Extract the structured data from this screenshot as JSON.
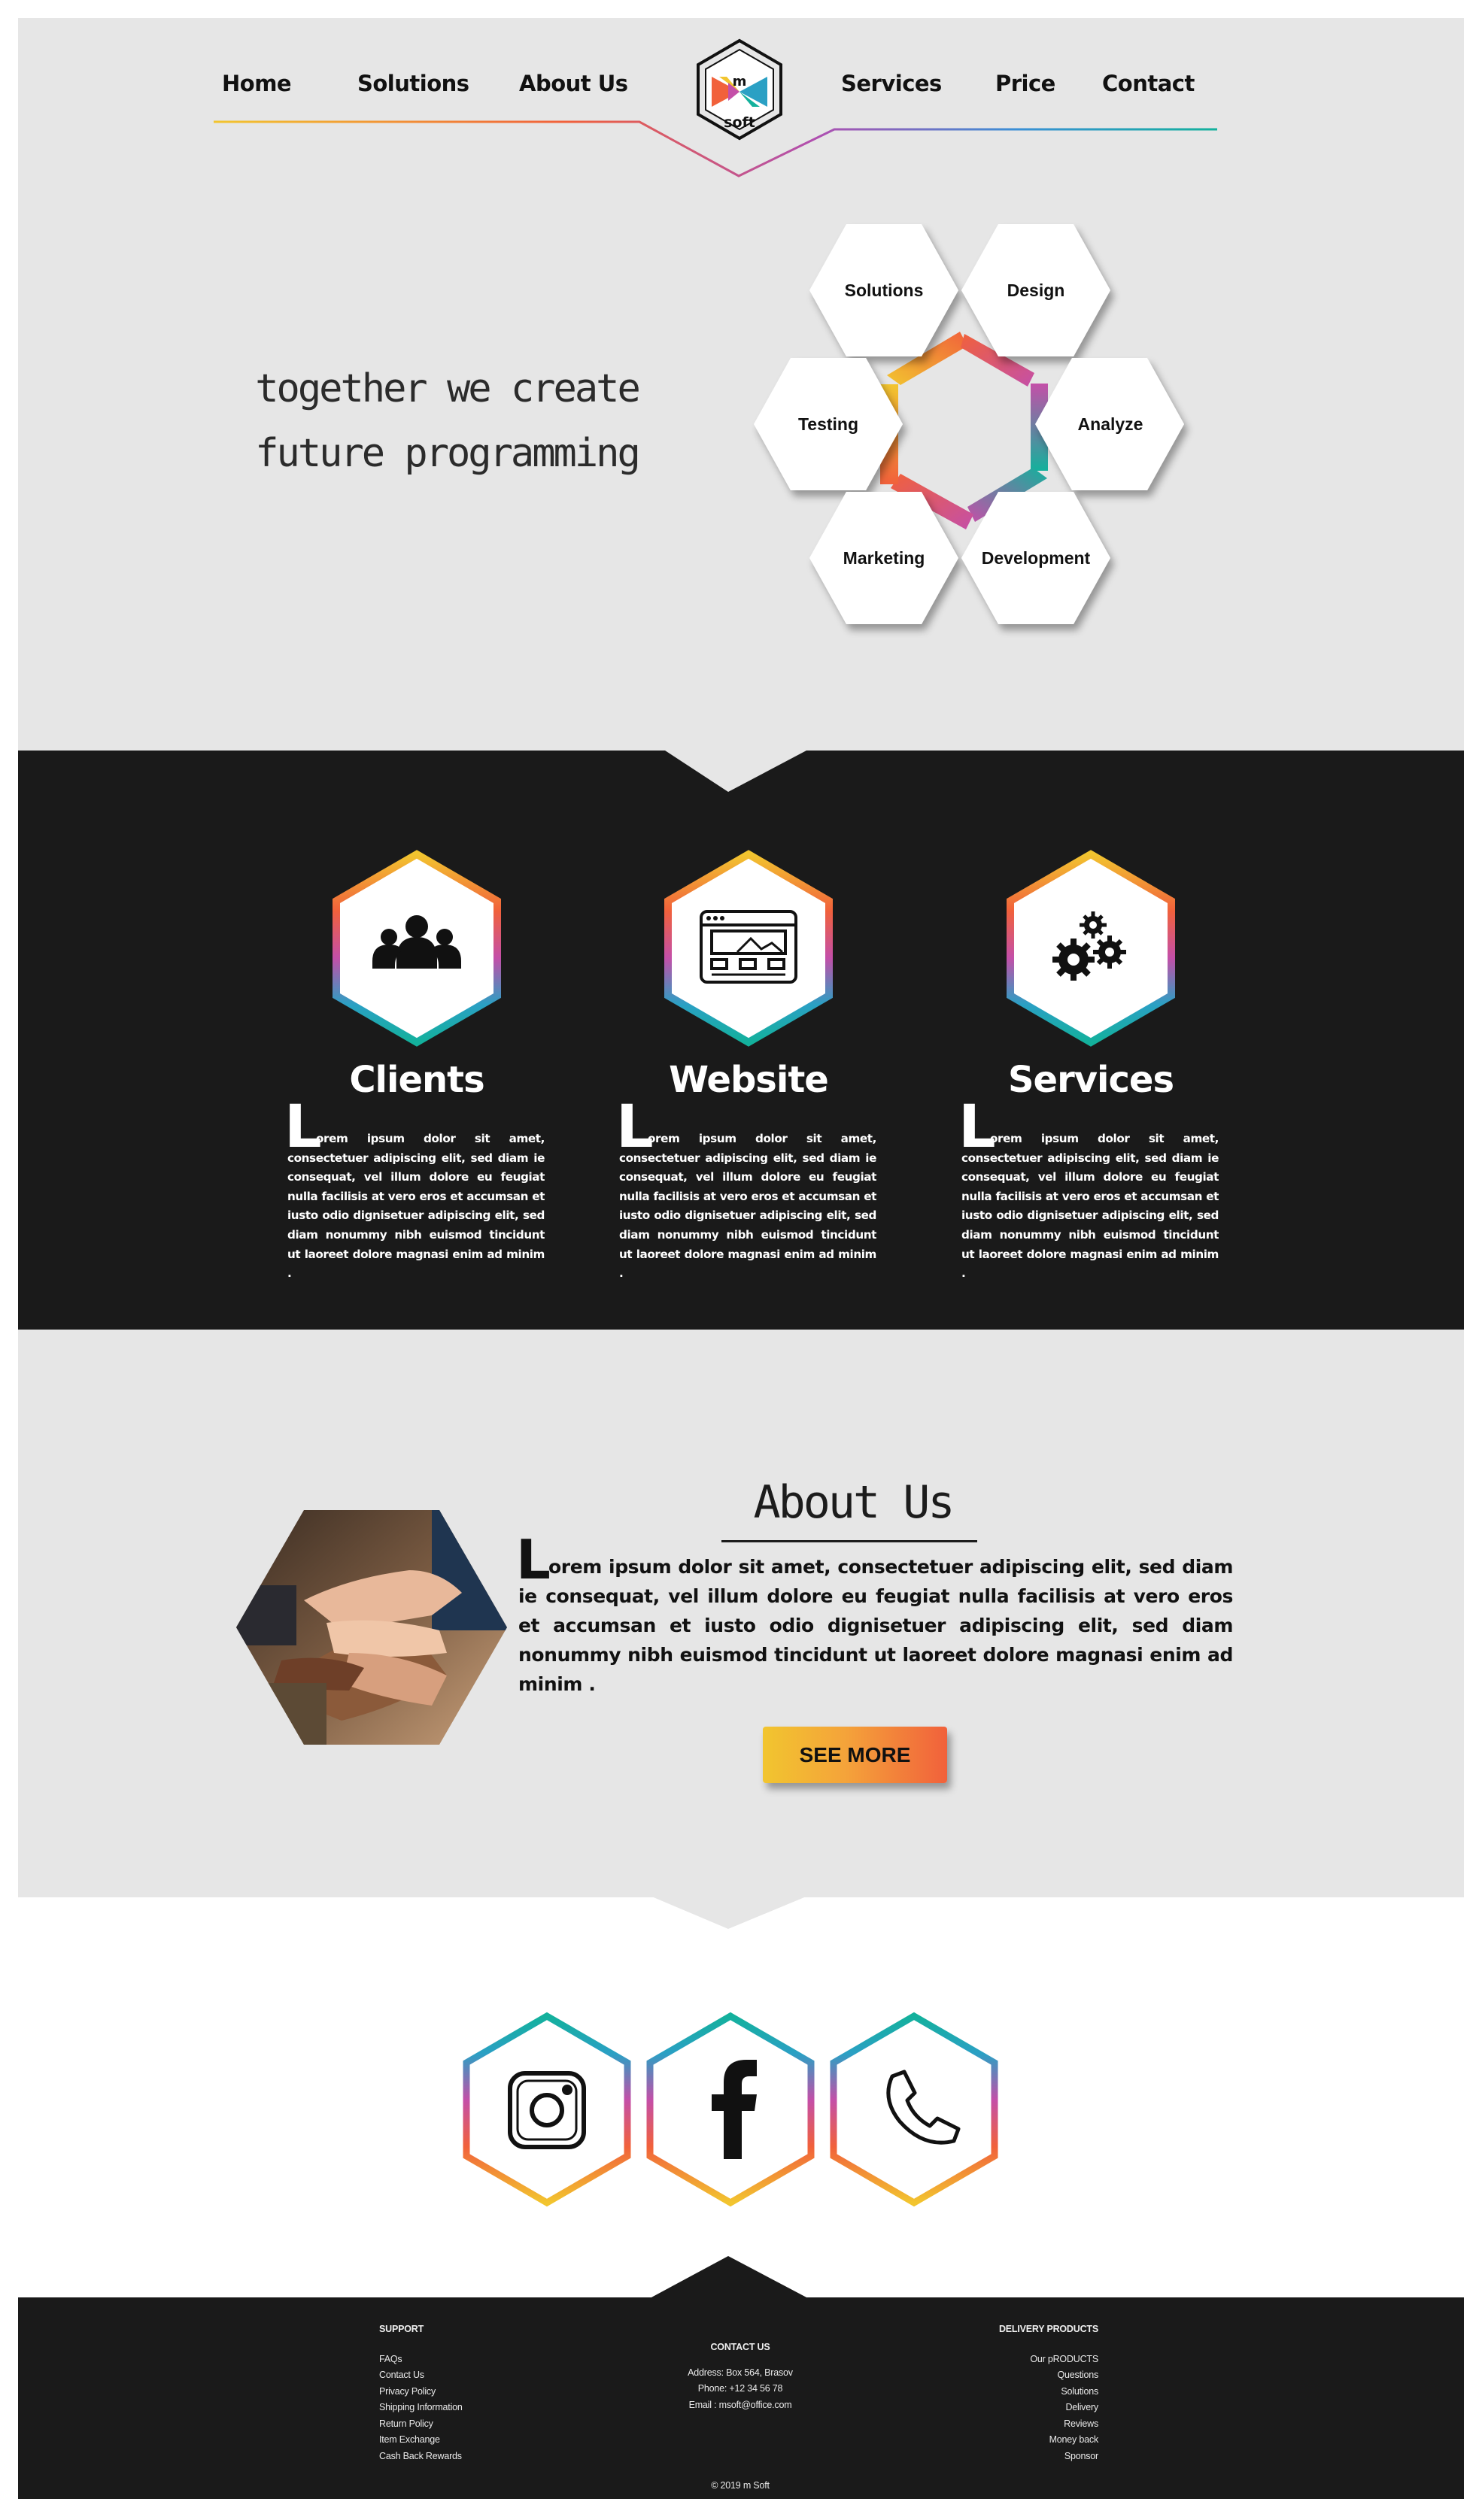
{
  "nav": {
    "items_left": [
      "Home",
      "Solutions",
      "About Us"
    ],
    "items_right": [
      "Services",
      "Price",
      "Contact"
    ],
    "logo_top": "m",
    "logo_bottom": "soft"
  },
  "hero": {
    "tagline_line1": "together we create",
    "tagline_line2": "future programming",
    "hexagons": [
      "Solutions",
      "Design",
      "Testing",
      "Analyze",
      "Marketing",
      "Development"
    ]
  },
  "features": [
    {
      "title": "Clients",
      "icon": "users-icon",
      "cap": "L",
      "text": "orem ipsum dolor sit amet, consectetuer adipiscing elit, sed diam ie consequat, vel illum dolore eu feugiat nulla facilisis at vero eros et accumsan et iusto odio dignisetuer adipiscing elit, sed diam nonummy nibh euismod tincidunt ut laoreet dolore magnasi enim ad minim ."
    },
    {
      "title": "Website",
      "icon": "website-icon",
      "cap": "L",
      "text": "orem ipsum dolor sit amet, consectetuer adipiscing elit, sed diam ie consequat, vel illum dolore eu feugiat nulla facilisis at vero eros et accumsan et iusto odio dignisetuer adipiscing elit, sed diam nonummy nibh euismod tincidunt ut laoreet dolore magnasi enim ad minim ."
    },
    {
      "title": "Services",
      "icon": "gears-icon",
      "cap": "L",
      "text": "orem ipsum dolor sit amet, consectetuer adipiscing elit, sed diam ie consequat, vel illum dolore eu feugiat nulla facilisis at vero eros et accumsan et iusto odio dignisetuer adipiscing elit, sed diam nonummy nibh euismod tincidunt ut laoreet dolore magnasi enim ad minim ."
    }
  ],
  "about": {
    "title": "About Us",
    "cap": "L",
    "text": "orem ipsum dolor sit amet, consectetuer adipiscing elit, sed diam ie consequat, vel illum dolore eu feugiat nulla facilisis at vero eros et accumsan et iusto odio dignisetuer adipiscing elit, sed diam nonummy nibh euismod tincidunt ut laoreet dolore magnasi enim ad minim .",
    "button": "SEE MORE"
  },
  "social": [
    "instagram-icon",
    "facebook-icon",
    "phone-icon"
  ],
  "footer": {
    "support_heading": "SUPPORT",
    "support_links": [
      "FAQs",
      "Contact Us",
      "Privacy Policy",
      "Shipping Information",
      "Return Policy",
      "Item Exchange",
      "Cash Back Rewards"
    ],
    "contact_heading": "CONTACT US",
    "contact_lines": [
      "Address: Box 564, Brasov",
      "Phone: +12 34 56 78",
      "Email : msoft@office.com"
    ],
    "products_heading": "DELIVERY PRODUCTS",
    "products_links": [
      "Our pRODUCTS",
      "Questions",
      "Solutions",
      "Delivery",
      "Reviews",
      "Money back",
      "Sponsor"
    ],
    "copyright": "© 2019 m Soft"
  },
  "colors": {
    "bg_light": "#e6e6e6",
    "bg_dark": "#1a1a1a",
    "yellow": "#f2c52f",
    "orange": "#f1613b",
    "magenta": "#c44fa8",
    "teal": "#13b19c"
  }
}
